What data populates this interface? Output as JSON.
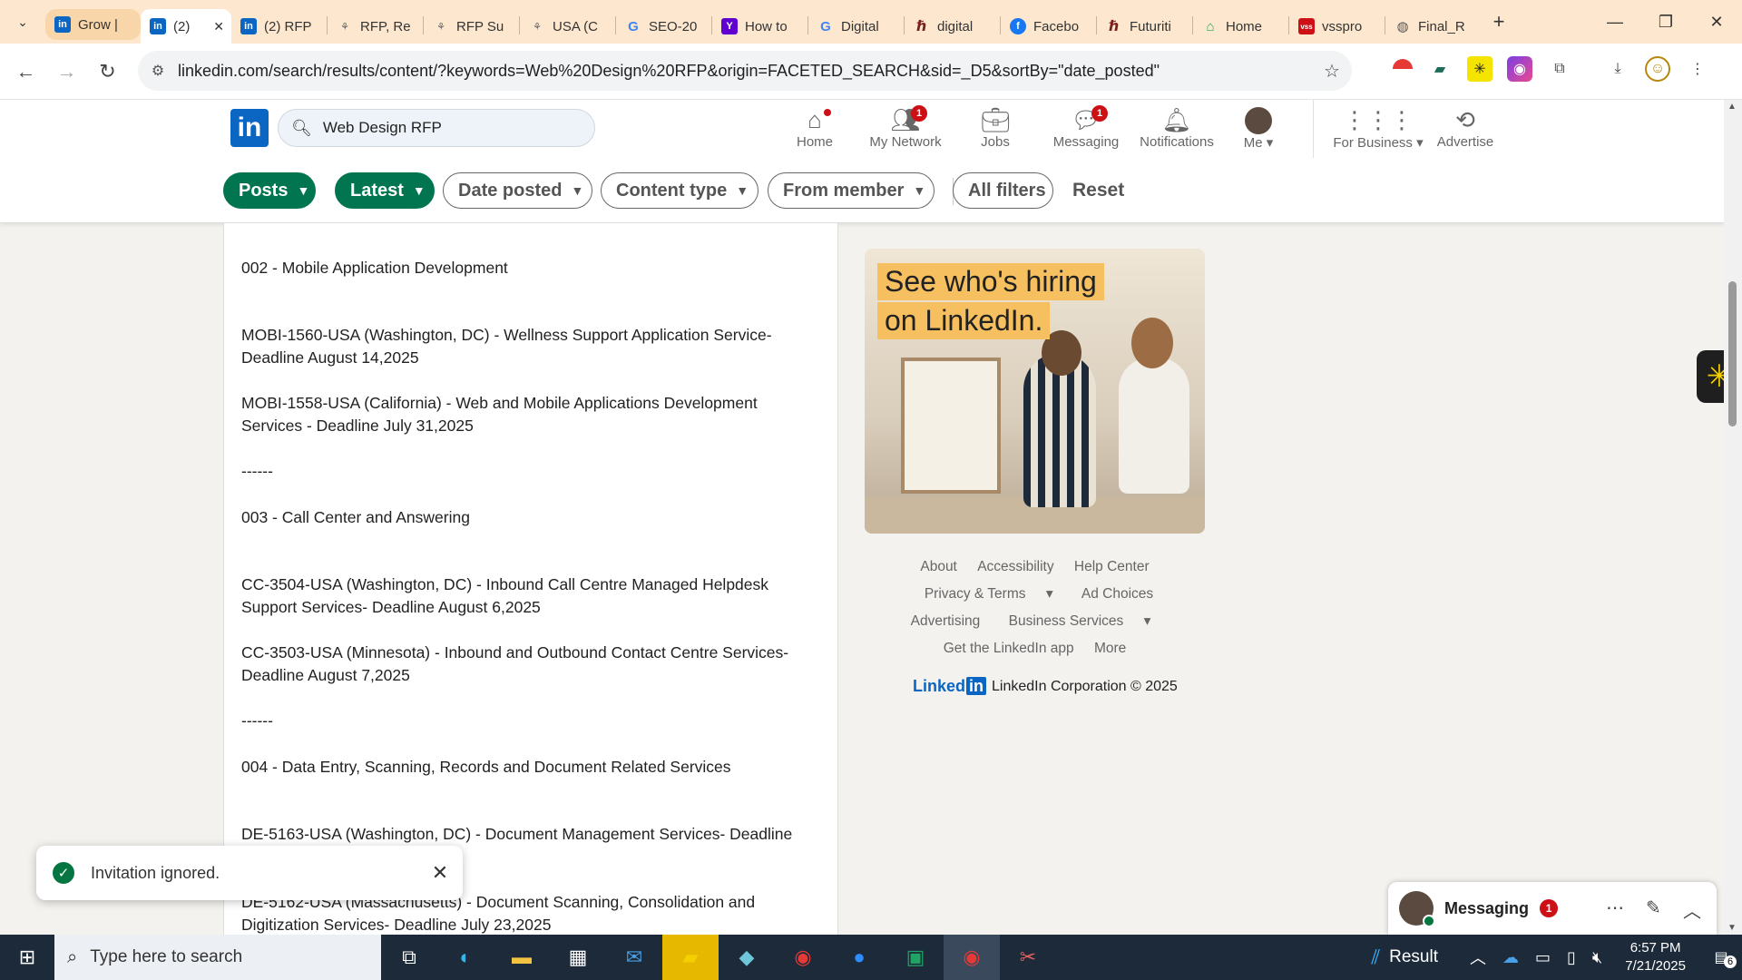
{
  "browser": {
    "tabs": [
      {
        "label": "Grow |",
        "icon": "linkedin",
        "color": "#0a66c2"
      },
      {
        "label": "(2)",
        "icon": "linkedin",
        "color": "#0a66c2"
      },
      {
        "label": "(2) RFP",
        "icon": "linkedin",
        "color": "#0a66c2"
      },
      {
        "label": "RFP, Re",
        "icon": "handshake",
        "color": "#666666"
      },
      {
        "label": "RFP Su",
        "icon": "handshake",
        "color": "#666666"
      },
      {
        "label": "USA (C",
        "icon": "handshake",
        "color": "#666666"
      },
      {
        "label": "SEO-20",
        "icon": "google",
        "color": "#4285f4"
      },
      {
        "label": "How to",
        "icon": "yahoo",
        "color": "#6001d2"
      },
      {
        "label": "Digital",
        "icon": "google",
        "color": "#4285f4"
      },
      {
        "label": "digital",
        "icon": "futurity",
        "color": "#7a1f1f"
      },
      {
        "label": "Facebo",
        "icon": "facebook",
        "color": "#1877f2"
      },
      {
        "label": "Futuriti",
        "icon": "futurity",
        "color": "#7a1f1f"
      },
      {
        "label": "Home",
        "icon": "home-app",
        "color": "#21a366"
      },
      {
        "label": "vsspro",
        "icon": "vss",
        "color": "#cc1016"
      },
      {
        "label": "Final_R",
        "icon": "globe",
        "color": "#555555"
      }
    ],
    "url": "linkedin.com/search/results/content/?keywords=Web%20Design%20RFP&origin=FACETED_SEARCH&sid=_D5&sortBy=\"date_posted\""
  },
  "linkedin": {
    "logo": "in",
    "search_value": "Web Design RFP",
    "nav": [
      {
        "label": "Home",
        "badge": ""
      },
      {
        "label": "My Network",
        "badge": "1"
      },
      {
        "label": "Jobs",
        "badge": ""
      },
      {
        "label": "Messaging",
        "badge": "1"
      },
      {
        "label": "Notifications",
        "badge": ""
      },
      {
        "label": "Me",
        "badge": ""
      },
      {
        "label": "For Business",
        "badge": ""
      },
      {
        "label": "Advertise",
        "badge": ""
      }
    ],
    "filters": {
      "posts": "Posts",
      "latest": "Latest",
      "date_posted": "Date posted",
      "content_type": "Content type",
      "from_member": "From member",
      "all_filters": "All filters",
      "reset": "Reset"
    }
  },
  "post": {
    "lines": [
      "------",
      "002 - Mobile Application Development",
      "MOBI-1560-USA (Washington, DC) - Wellness Support Application Service- Deadline August 14,2025",
      "MOBI-1558-USA (California) - Web and Mobile Applications Development Services - Deadline July 31,2025",
      "------",
      "003 - Call Center and Answering",
      "CC-3504-USA (Washington, DC) - Inbound Call Centre Managed Helpdesk Support Services- Deadline August 6,2025",
      "CC-3503-USA (Minnesota) - Inbound and Outbound Contact Centre Services- Deadline August 7,2025",
      "------",
      "004 - Data Entry, Scanning, Records and Document Related Services",
      "DE-5163-USA (Washington, DC) - Document Management Services- Deadline July",
      "DE-5162-USA (Massachusetts) - Document Scanning, Consolidation and Digitization Services- Deadline July 23,2025"
    ]
  },
  "rail": {
    "ad_line1": "See who's hiring",
    "ad_line2": "on LinkedIn.",
    "footer": {
      "about": "About",
      "accessibility": "Accessibility",
      "help_center": "Help Center",
      "privacy": "Privacy & Terms",
      "ad_choices": "Ad Choices",
      "advertising": "Advertising",
      "business_services": "Business Services",
      "get_app": "Get the LinkedIn app",
      "more": "More"
    },
    "corp_brand": "Linked",
    "corp_brand_in": "in",
    "corp": "LinkedIn Corporation © 2025"
  },
  "toast": {
    "message": "Invitation ignored."
  },
  "messaging": {
    "title": "Messaging",
    "badge": "1"
  },
  "taskbar": {
    "search_placeholder": "Type here to search",
    "weather": "Result",
    "time": "6:57 PM",
    "date": "7/21/2025",
    "notifications": "6"
  }
}
